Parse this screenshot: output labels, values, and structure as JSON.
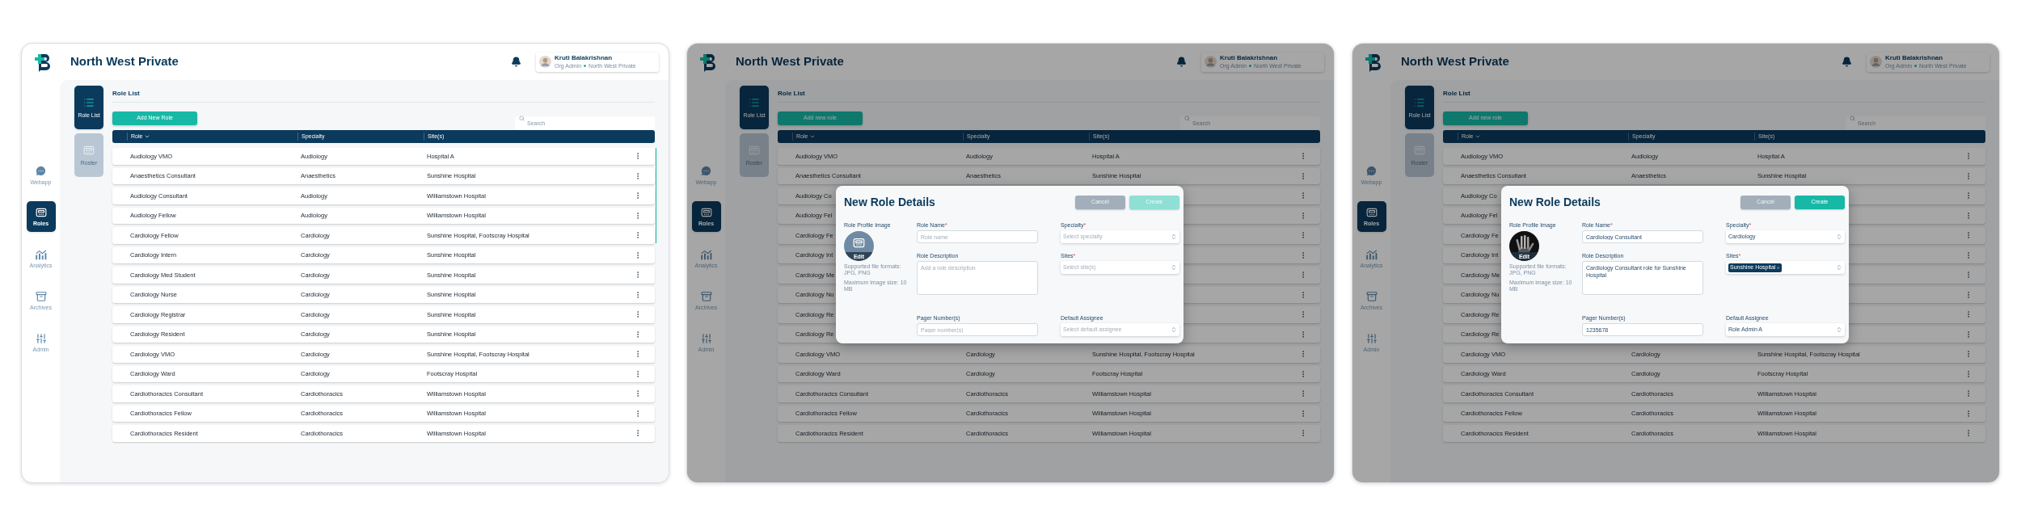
{
  "screens": [
    {
      "dimmed": false,
      "app_title": "North West Private",
      "user": {
        "name": "Kruti Balakrishnan",
        "role": "Org Admin",
        "org": "North West Private"
      },
      "nav": [
        {
          "label": "Webapp",
          "kind": "chat",
          "selected": false
        },
        {
          "label": "Roles",
          "kind": "pager",
          "selected": true
        },
        {
          "label": "Analytics",
          "kind": "analytics",
          "selected": false
        },
        {
          "label": "Archives",
          "kind": "archive",
          "selected": false
        },
        {
          "label": "Admin",
          "kind": "sliders",
          "selected": false
        }
      ],
      "subnav": [
        {
          "label": "Role List",
          "kind": "list",
          "selected": true
        },
        {
          "label": "Roster",
          "kind": "pager",
          "selected": false
        }
      ],
      "heading": "Role List",
      "add_button": "Add New Role",
      "search": {
        "placeholder": "Search"
      },
      "table": {
        "columns": [
          "Role",
          "Specialty",
          "Site(s)"
        ],
        "rows": [
          {
            "role": "Audiology VMO",
            "specialty": "Audiology",
            "sites": "Hospital A"
          },
          {
            "role": "Anaesthetics Consultant",
            "specialty": "Anaesthetics",
            "sites": "Sunshine Hospital"
          },
          {
            "role": "Audiology Consultant",
            "specialty": "Audiology",
            "sites": "Williamstown Hospital"
          },
          {
            "role": "Audiology Fellow",
            "specialty": "Audiology",
            "sites": "Williamstown Hospital"
          },
          {
            "role": "Cardiology Fellow",
            "specialty": "Cardiology",
            "sites": "Sunshine Hospital, Footscray Hospital"
          },
          {
            "role": "Cardiology Intern",
            "specialty": "Cardiology",
            "sites": "Sunshine Hospital"
          },
          {
            "role": "Cardiology Med Student",
            "specialty": "Cardiology",
            "sites": "Sunshine Hospital"
          },
          {
            "role": "Cardiology Nurse",
            "specialty": "Cardiology",
            "sites": "Sunshine Hospital"
          },
          {
            "role": "Cardiology Registrar",
            "specialty": "Cardiology",
            "sites": "Sunshine Hospital"
          },
          {
            "role": "Cardiology Resident",
            "specialty": "Cardiology",
            "sites": "Sunshine Hospital"
          },
          {
            "role": "Cardiology VMO",
            "specialty": "Cardiology",
            "sites": "Sunshine Hospital, Footscray Hospital"
          },
          {
            "role": "Cardiology Ward",
            "specialty": "Cardiology",
            "sites": "Footscray Hospital"
          },
          {
            "role": "Cardiothoracics Consultant",
            "specialty": "Cardiothoracics",
            "sites": "Williamstown Hospital"
          },
          {
            "role": "Cardiothoracics Fellow",
            "specialty": "Cardiothoracics",
            "sites": "Williamstown Hospital"
          },
          {
            "role": "Cardiothoracics Resident",
            "specialty": "Cardiothoracics",
            "sites": "Williamstown Hospital"
          }
        ]
      }
    },
    {
      "dimmed": true,
      "app_title": "North West Private",
      "user": {
        "name": "Kruti Balakrishnan",
        "role": "Org Admin",
        "org": "North West Private"
      },
      "nav": [
        {
          "label": "Webapp",
          "kind": "chat",
          "selected": false
        },
        {
          "label": "Roles",
          "kind": "pager",
          "selected": true
        },
        {
          "label": "Analytics",
          "kind": "analytics",
          "selected": false
        },
        {
          "label": "Archives",
          "kind": "archive",
          "selected": false
        },
        {
          "label": "Admin",
          "kind": "sliders",
          "selected": false
        }
      ],
      "subnav": [
        {
          "label": "Role List",
          "kind": "list",
          "selected": true
        },
        {
          "label": "Roster",
          "kind": "pager",
          "selected": false
        }
      ],
      "heading": "Role List",
      "add_button": "Add new role",
      "search": {
        "placeholder": "Search"
      },
      "table": {
        "columns": [
          "Role",
          "Specialty",
          "Site(s)"
        ],
        "rows": [
          {
            "role": "Audiology VMO",
            "specialty": "Audiology",
            "sites": "Hospital A"
          },
          {
            "role": "Anaesthetics Consultant",
            "specialty": "Anaesthetics",
            "sites": "Sunshine Hospital"
          },
          {
            "role": "Audiology Co"
          },
          {
            "role": "Audiology Fel"
          },
          {
            "role": "Cardiology Fe"
          },
          {
            "role": "Cardiology Int"
          },
          {
            "role": "Cardiology Me"
          },
          {
            "role": "Cardiology Nu"
          },
          {
            "role": "Cardiology Re"
          },
          {
            "role": "Cardiology Re"
          },
          {
            "role": "Cardiology VMO",
            "specialty": "Cardiology",
            "sites": "Sunshine Hospital, Footscray Hospital"
          },
          {
            "role": "Cardiology Ward",
            "specialty": "Cardiology",
            "sites": "Footscray Hospital"
          },
          {
            "role": "Cardiothoracics Consultant",
            "specialty": "Cardiothoracics",
            "sites": "Williamstown Hospital"
          },
          {
            "role": "Cardiothoracics Fellow",
            "specialty": "Cardiothoracics",
            "sites": "Williamstown Hospital"
          },
          {
            "role": "Cardiothoracics Resident",
            "specialty": "Cardiothoracics",
            "sites": "Williamstown Hospital"
          }
        ]
      },
      "modal": {
        "title": "New Role Details",
        "buttons": [
          {
            "label": "Cancel",
            "kind": "cancel",
            "disabled": false
          },
          {
            "label": "Create",
            "kind": "create",
            "disabled": true
          }
        ],
        "image": {
          "label": "Role Profile Image",
          "kind": "placeholder",
          "edit": "Edit",
          "formats": "Supported file formats: JPG, PNG",
          "max_size": "Maximum image size: 10 MB"
        },
        "form_columns": [
          {
            "fields": [
              {
                "label": "Role Name",
                "required_mark": "*",
                "kind": "text",
                "placeholder": "Role name"
              },
              {
                "label": "Role Description",
                "kind": "textarea",
                "placeholder": "Add a role description"
              },
              {
                "label": "Pager Number(s)",
                "kind": "text",
                "placeholder": "Pager number(s)"
              }
            ]
          },
          {
            "fields": [
              {
                "label": "Specialty",
                "required_mark": "*",
                "kind": "select",
                "placeholder": "Select specialty"
              },
              {
                "label": "Sites",
                "required_mark": "*",
                "kind": "select",
                "placeholder": "Select site(s)"
              },
              {
                "label": "Default Assignee",
                "kind": "select",
                "placeholder": "Select default assignee"
              }
            ]
          }
        ]
      }
    },
    {
      "dimmed": true,
      "app_title": "North West Private",
      "user": {
        "name": "Kruti Balakrishnan",
        "role": "Org Admin",
        "org": "North West Private"
      },
      "nav": [
        {
          "label": "Webapp",
          "kind": "chat",
          "selected": false
        },
        {
          "label": "Roles",
          "kind": "pager",
          "selected": true
        },
        {
          "label": "Analytics",
          "kind": "analytics",
          "selected": false
        },
        {
          "label": "Archives",
          "kind": "archive",
          "selected": false
        },
        {
          "label": "Admin",
          "kind": "sliders",
          "selected": false
        }
      ],
      "subnav": [
        {
          "label": "Role List",
          "kind": "list",
          "selected": true
        },
        {
          "label": "Roster",
          "kind": "pager",
          "selected": false
        }
      ],
      "heading": "Role List",
      "add_button": "Add new role",
      "search": {
        "placeholder": "Search"
      },
      "table": {
        "columns": [
          "Role",
          "Specialty",
          "Site(s)"
        ],
        "rows": [
          {
            "role": "Audiology VMO",
            "specialty": "Audiology",
            "sites": "Hospital A"
          },
          {
            "role": "Anaesthetics Consultant",
            "specialty": "Anaesthetics",
            "sites": "Sunshine Hospital"
          },
          {
            "role": "Audiology Co"
          },
          {
            "role": "Audiology Fel"
          },
          {
            "role": "Cardiology Fe"
          },
          {
            "role": "Cardiology Int"
          },
          {
            "role": "Cardiology Me"
          },
          {
            "role": "Cardiology Nu"
          },
          {
            "role": "Cardiology Re"
          },
          {
            "role": "Cardiology Re"
          },
          {
            "role": "Cardiology VMO",
            "specialty": "Cardiology",
            "sites": "Sunshine Hospital, Footscray Hospital"
          },
          {
            "role": "Cardiology Ward",
            "specialty": "Cardiology",
            "sites": "Footscray Hospital"
          },
          {
            "role": "Cardiothoracics Consultant",
            "specialty": "Cardiothoracics",
            "sites": "Williamstown Hospital"
          },
          {
            "role": "Cardiothoracics Fellow",
            "specialty": "Cardiothoracics",
            "sites": "Williamstown Hospital"
          },
          {
            "role": "Cardiothoracics Resident",
            "specialty": "Cardiothoracics",
            "sites": "Williamstown Hospital"
          }
        ]
      },
      "modal": {
        "title": "New Role Details",
        "buttons": [
          {
            "label": "Cancel",
            "kind": "cancel",
            "disabled": false
          },
          {
            "label": "Create",
            "kind": "create",
            "disabled": false
          }
        ],
        "image": {
          "label": "Role Profile Image",
          "kind": "picture",
          "edit": "Edit",
          "formats": "Supported file formats: JPG, PNG",
          "max_size": "Maximum image size: 10 MB"
        },
        "form_columns": [
          {
            "fields": [
              {
                "label": "Role Name",
                "required_mark": "*",
                "kind": "text",
                "value": "Cardiology Consultant"
              },
              {
                "label": "Role Description",
                "kind": "textarea",
                "value": "Cardiology Consultant role for Sunshine Hospital"
              },
              {
                "label": "Pager Number(s)",
                "kind": "text",
                "value": "1235678"
              }
            ]
          },
          {
            "fields": [
              {
                "label": "Specialty",
                "required_mark": "*",
                "kind": "select",
                "value": "Cardiology"
              },
              {
                "label": "Sites",
                "required_mark": "*",
                "kind": "select",
                "chips": [
                  {
                    "label": "Sunshine Hospital"
                  }
                ]
              },
              {
                "label": "Default Assignee",
                "kind": "select",
                "value": "Role Admin A"
              }
            ]
          }
        ]
      }
    }
  ]
}
